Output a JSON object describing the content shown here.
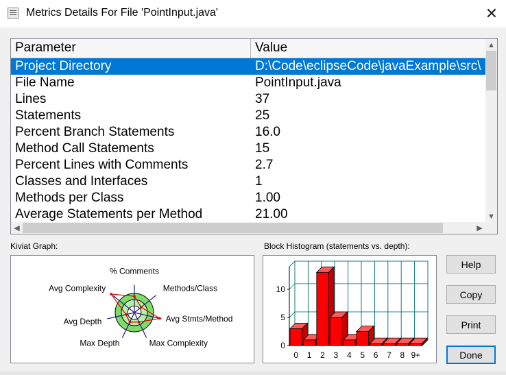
{
  "window": {
    "title": "Metrics Details For File 'PointInput.java'",
    "close_glyph": "✕"
  },
  "table": {
    "headers": {
      "parameter": "Parameter",
      "value": "Value"
    },
    "rows": [
      {
        "parameter": "Project Directory",
        "value": "D:\\Code\\eclipseCode\\javaExample\\src\\",
        "selected": true
      },
      {
        "parameter": "File Name",
        "value": "PointInput.java"
      },
      {
        "parameter": "Lines",
        "value": "37"
      },
      {
        "parameter": "Statements",
        "value": "25"
      },
      {
        "parameter": "Percent Branch Statements",
        "value": "16.0"
      },
      {
        "parameter": "Method Call Statements",
        "value": "15"
      },
      {
        "parameter": "Percent Lines with Comments",
        "value": "2.7"
      },
      {
        "parameter": "Classes and Interfaces",
        "value": "1"
      },
      {
        "parameter": "Methods per Class",
        "value": "1.00"
      },
      {
        "parameter": "Average Statements per Method",
        "value": "21.00"
      }
    ],
    "selection_color": "#0078d7"
  },
  "kiviat": {
    "label": "Kiviat Graph:",
    "axes": [
      "% Comments",
      "Methods/Class",
      "Avg Stmts/Method",
      "Max Complexity",
      "Max Depth",
      "Avg Depth",
      "Avg Complexity"
    ],
    "values": [
      0.85,
      0.45,
      1.35,
      0.55,
      0.55,
      0.45,
      1.55
    ],
    "ring_color": "#7ddc6a",
    "inner_color": "#b9f0a8",
    "line_color": "#e00000"
  },
  "histogram": {
    "label": "Block Histogram (statements vs. depth):",
    "chart_data": {
      "type": "bar",
      "categories": [
        "0",
        "1",
        "2",
        "3",
        "4",
        "5",
        "6",
        "7",
        "8",
        "9+"
      ],
      "values": [
        3,
        1,
        13,
        5,
        1,
        2.5,
        0,
        0,
        0,
        0
      ],
      "yticks": [
        "0",
        "5",
        "10"
      ],
      "ylim": [
        0,
        14
      ],
      "grid": true,
      "bar_color": "#ff0000",
      "grid_color": "#0b7a7a"
    }
  },
  "buttons": {
    "help": "Help",
    "copy": "Copy",
    "print": "Print",
    "done": "Done"
  }
}
